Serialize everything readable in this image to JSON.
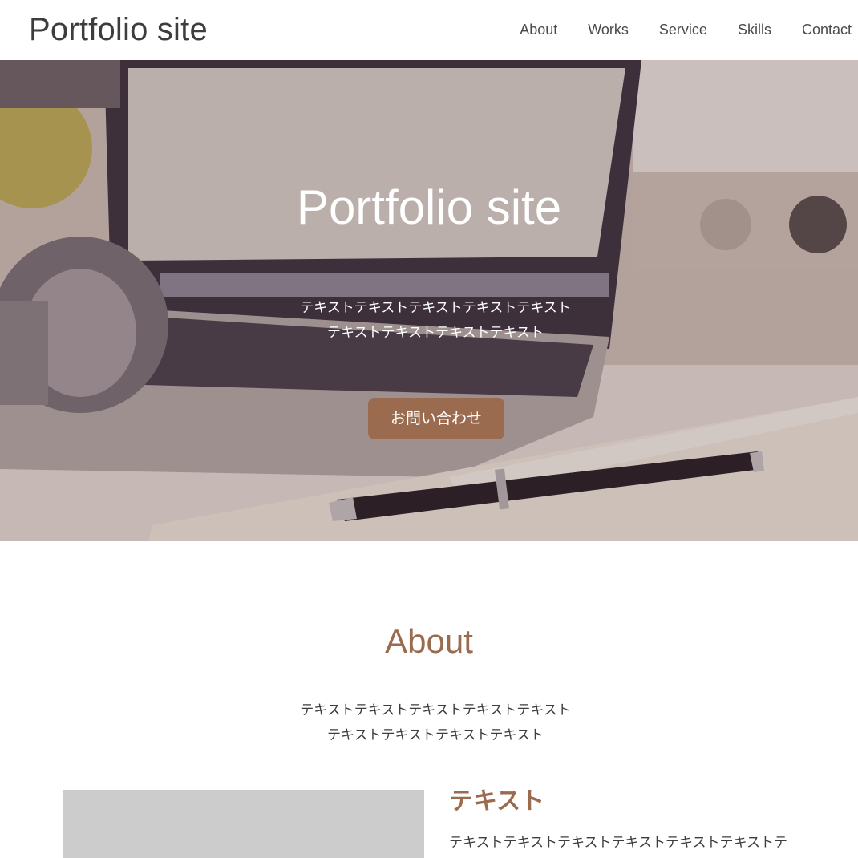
{
  "header": {
    "logo": "Portfolio site",
    "nav": [
      "About",
      "Works",
      "Service",
      "Skills",
      "Contact"
    ]
  },
  "hero": {
    "title": "Portfolio site",
    "text": "テキストテキストテキストテキストテキストテキストテキストテキストテキスト",
    "button_label": "お問い合わせ"
  },
  "about": {
    "title": "About",
    "text": "テキストテキストテキストテキストテキストテキストテキストテキストテキスト",
    "subheading": "テキスト",
    "body": "テキストテキストテキストテキストテキストテキストテ"
  },
  "colors": {
    "accent": "#9b6b4f",
    "text": "#3d3d3d",
    "placeholder": "#cccccc"
  }
}
